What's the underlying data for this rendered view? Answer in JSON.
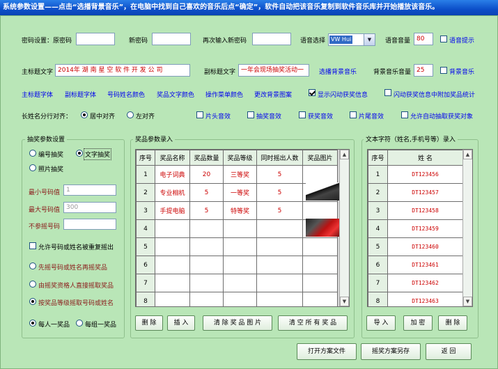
{
  "window": {
    "title": "系统参数设置——点击“选播背景音乐”，在电脑中找到自己喜欢的音乐后点“确定”，软件自动把该音乐复制到软件音乐库并开始播放该音乐。"
  },
  "row1": {
    "pwd_label": "密码设置：原密码",
    "new_pwd_label": "新密码",
    "confirm_pwd_label": "再次输入新密码",
    "lang_label": "语音选择",
    "lang_value": "VW Hui",
    "volume_label": "语音音量",
    "volume_value": "80",
    "voice_hint_label": "语音提示"
  },
  "row2": {
    "main_title_label": "主标题文字",
    "main_title_value": "2014年 湖 南 星 空 软 件 开 发 公 司",
    "sub_title_label": "副标题文字",
    "sub_title_value": "一年会现场抽奖活动一",
    "select_music_link": "选播背景音乐",
    "bg_volume_label": "背景音乐音量",
    "bg_volume_value": "25",
    "bg_music_label": "背景音乐"
  },
  "row3": {
    "links": [
      "主标题字体",
      "副标题字体",
      "号码姓名颜色",
      "奖品文字颜色",
      "操作菜单颜色",
      "更改背景图案"
    ],
    "show_winner_label": "显示闪动获奖信息",
    "append_stats_label": "闪动获奖信息中附加奖品统计"
  },
  "row4": {
    "long_name_label": "长姓名分行对齐：",
    "center_label": "居中对齐",
    "left_label": "左对齐",
    "sounds": [
      "片头音效",
      "抽奖音效",
      "获奖音效",
      "片尾音效"
    ],
    "auto_pick_label": "允许自动抽取获奖对象"
  },
  "lottery": {
    "title": "抽奖参数设置",
    "mode_number": "编号抽奖",
    "mode_text": "文字抽奖",
    "mode_photo": "照片抽奖",
    "min_label": "最小号码值",
    "min_value": "1",
    "max_label": "最大号码值",
    "max_value": "300",
    "exclude_label": "不参摇号码",
    "exclude_value": "",
    "allow_repeat_label": "允许号码或姓名被重复摇出",
    "opt1": "先摇号码或姓名再摇奖品",
    "opt2": "由摇奖资格人直接摇取奖品",
    "opt3": "按奖品等级摇取号码或姓名",
    "per_person": "每人一奖品",
    "per_group": "每组一奖品"
  },
  "prizes": {
    "title": "奖品参数录入",
    "headers": [
      "序号",
      "奖品名称",
      "奖品数量",
      "奖品等级",
      "同时摇出人数",
      "奖品图片"
    ],
    "rows": [
      {
        "no": "1",
        "name": "电子词典",
        "qty": "20",
        "level": "三等奖",
        "count": "5"
      },
      {
        "no": "2",
        "name": "专业相机",
        "qty": "5",
        "level": "一等奖",
        "count": "5"
      },
      {
        "no": "3",
        "name": "手提电脑",
        "qty": "5",
        "level": "特等奖",
        "count": "5"
      },
      {
        "no": "4",
        "name": "",
        "qty": "",
        "level": "",
        "count": ""
      },
      {
        "no": "5",
        "name": "",
        "qty": "",
        "level": "",
        "count": ""
      },
      {
        "no": "6",
        "name": "",
        "qty": "",
        "level": "",
        "count": ""
      },
      {
        "no": "7",
        "name": "",
        "qty": "",
        "level": "",
        "count": ""
      },
      {
        "no": "8",
        "name": "",
        "qty": "",
        "level": "",
        "count": ""
      }
    ],
    "btn_delete": "删 除",
    "btn_insert": "插 入",
    "btn_clear_images": "清 除 奖 品 图 片",
    "btn_clear_all": "清 空 所 有 奖 品"
  },
  "names": {
    "title": "文本字符（姓名,手机号等）录入",
    "headers": [
      "序号",
      "姓  名"
    ],
    "rows": [
      {
        "no": "1",
        "name": "DT123456"
      },
      {
        "no": "2",
        "name": "DT123457"
      },
      {
        "no": "3",
        "name": "DT123458"
      },
      {
        "no": "4",
        "name": "DT123459"
      },
      {
        "no": "5",
        "name": "DT123460"
      },
      {
        "no": "6",
        "name": "DT123461"
      },
      {
        "no": "7",
        "name": "DT123462"
      },
      {
        "no": "8",
        "name": "DT123463"
      }
    ],
    "btn_import": "导 入",
    "btn_encrypt": "加 密",
    "btn_delete": "删 除"
  },
  "footer": {
    "open_plan": "打开方案文件",
    "save_plan": "摇奖方案另存",
    "back": "返  回"
  }
}
